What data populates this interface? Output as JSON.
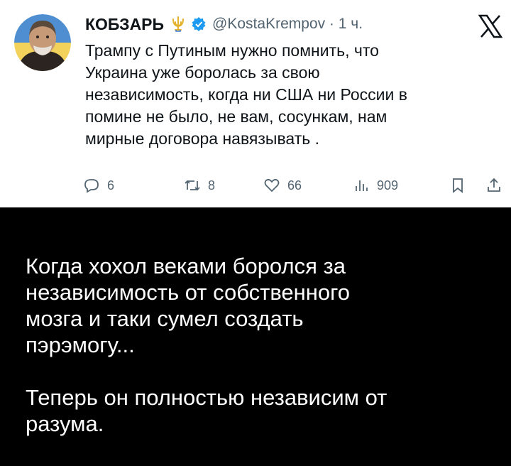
{
  "tweet": {
    "author_name": "КОБЗАРЬ",
    "emoji": "trident-emoji",
    "verified": "verified-badge",
    "handle_time": "@KostaKrempov · 1 ч.",
    "body_lines": [
      "Трампу с Путиным нужно помнить, что",
      "Украина уже боролась за свою",
      "независимость, когда ни США ни России в",
      "помине не было, не вам, сосункам, нам",
      "мирные договора навязывать ."
    ],
    "platform_logo": "x-logo-icon",
    "actions": {
      "replies": "6",
      "retweets": "8",
      "likes": "66",
      "views": "909"
    }
  },
  "meme": {
    "lines": [
      "Когда хохол веками боролся за",
      "независимость от собственного",
      "мозга и таки сумел создать",
      "пэрэмогу..."
    ],
    "punchline_lines": [
      "Теперь он полностью независим от",
      "разума."
    ]
  },
  "colors": {
    "tweet_bg": "#ffffff",
    "meme_bg": "#000000",
    "verified_blue": "#1d9bf0",
    "muted_gray": "#536471",
    "trident_gold": "#e3b12a"
  }
}
